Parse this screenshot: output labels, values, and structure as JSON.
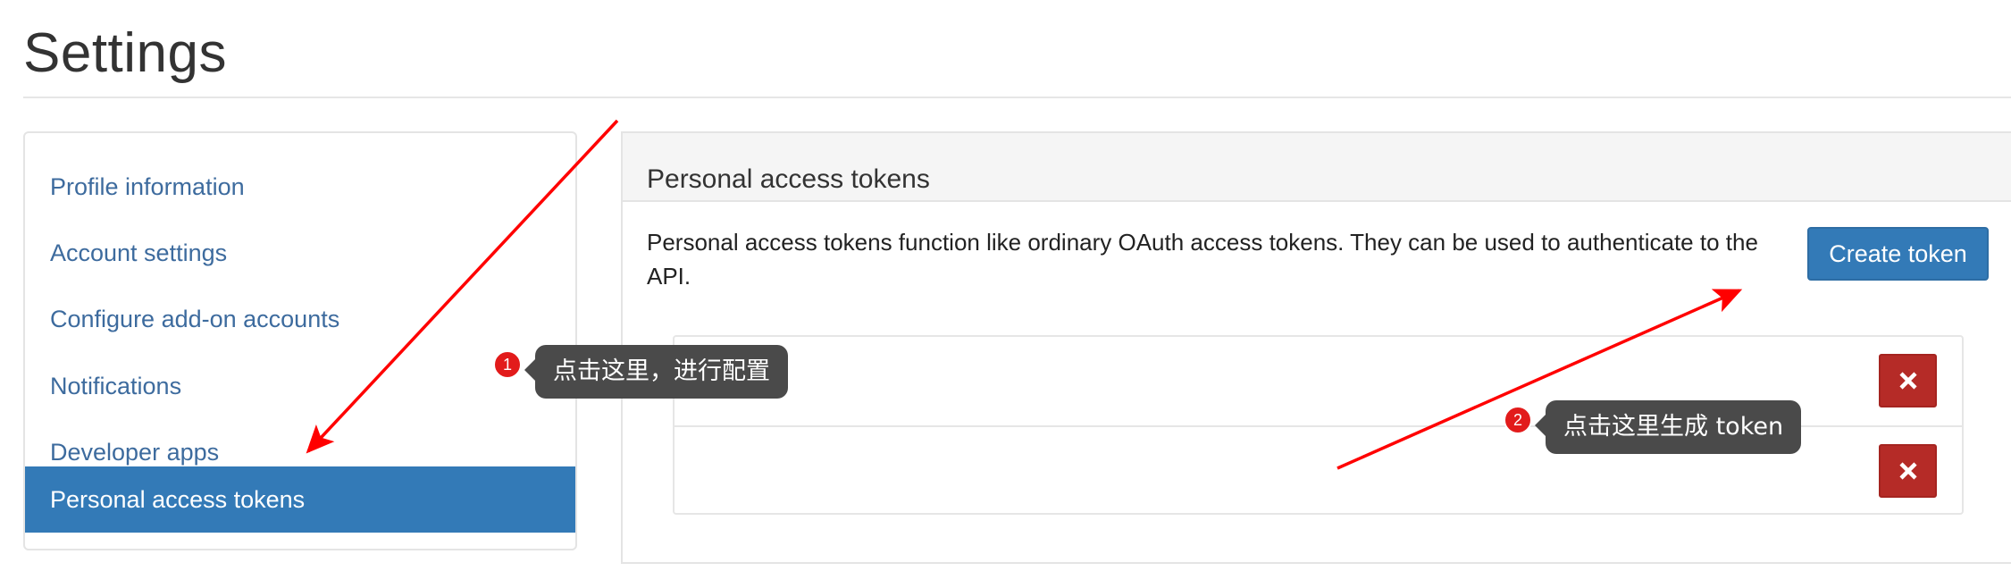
{
  "page": {
    "title": "Settings"
  },
  "sidebar": {
    "items": [
      {
        "label": "Profile information",
        "active": false
      },
      {
        "label": "Account settings",
        "active": false
      },
      {
        "label": "Configure add-on accounts",
        "active": false
      },
      {
        "label": "Notifications",
        "active": false
      },
      {
        "label": "Developer apps",
        "active": false
      },
      {
        "label": "Personal access tokens",
        "active": true
      }
    ]
  },
  "panel": {
    "title": "Personal access tokens",
    "description": "Personal access tokens function like ordinary OAuth access tokens. They can be used to authenticate to the API.",
    "create_label": "Create token",
    "tokens": [
      {
        "delete_icon": "x-icon"
      },
      {
        "delete_icon": "x-icon"
      }
    ]
  },
  "annotations": {
    "step1": {
      "number": "1",
      "text": "点击这里，进行配置"
    },
    "step2": {
      "number": "2",
      "text": "点击这里生成 token"
    }
  },
  "colors": {
    "accent": "#337ab7",
    "link": "#3d6b9e",
    "danger": "#b52b27",
    "annotation_arrow": "#ff0000",
    "annotation_badge": "#e21b1b",
    "tooltip_bg": "#4a4a4a"
  }
}
